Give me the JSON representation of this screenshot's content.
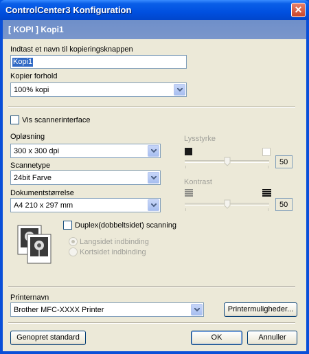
{
  "window": {
    "title": "ControlCenter3 Konfiguration"
  },
  "header": {
    "label": "[ KOPI ]  Kopi1"
  },
  "name_field": {
    "label": "Indtast et navn til kopieringsknappen",
    "value": "Kopi1"
  },
  "ratio": {
    "label": "Kopier forhold",
    "value": "100% kopi"
  },
  "scanner_interface": {
    "label": "Vis scannerinterface",
    "checked": false
  },
  "resolution": {
    "label": "Opløsning",
    "value": "300 x 300 dpi"
  },
  "scan_type": {
    "label": "Scannetype",
    "value": "24bit Farve"
  },
  "doc_size": {
    "label": "Dokumentstørrelse",
    "value": "A4 210 x 297 mm"
  },
  "brightness": {
    "label": "Lysstyrke",
    "value": "50",
    "level": 0.5
  },
  "contrast": {
    "label": "Kontrast",
    "value": "50",
    "level": 0.5
  },
  "duplex": {
    "label": "Duplex(dobbeltsidet) scanning",
    "checked": false,
    "options": [
      "Langsidet indbinding",
      "Kortsidet indbinding"
    ]
  },
  "printer": {
    "label": "Printernavn",
    "value": "Brother MFC-XXXX Printer",
    "options_button": "Printermuligheder..."
  },
  "footer": {
    "restore": "Genopret standard",
    "ok": "OK",
    "cancel": "Annuller"
  },
  "colors": {
    "titlebar": "#0a5fe8",
    "header_band": "#7a96cb",
    "face": "#ece9d8"
  }
}
